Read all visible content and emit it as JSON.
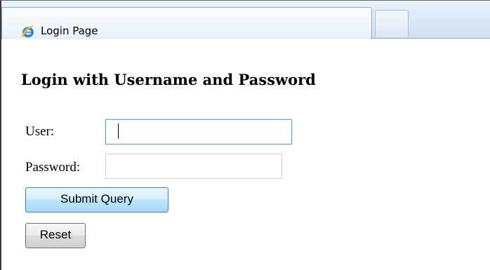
{
  "window": {
    "tab_title": "Login Page",
    "tab_icon": "internet-explorer-icon"
  },
  "form": {
    "heading": "Login with Username and Password",
    "user_label": "User:",
    "user_value": "",
    "password_label": "Password:",
    "password_value": "",
    "submit_label": "Submit Query",
    "reset_label": "Reset"
  },
  "colors": {
    "focus_border": "#6d9bd1",
    "submit_border": "#3c7fb1",
    "tab_bar": "#dbe7f6"
  }
}
